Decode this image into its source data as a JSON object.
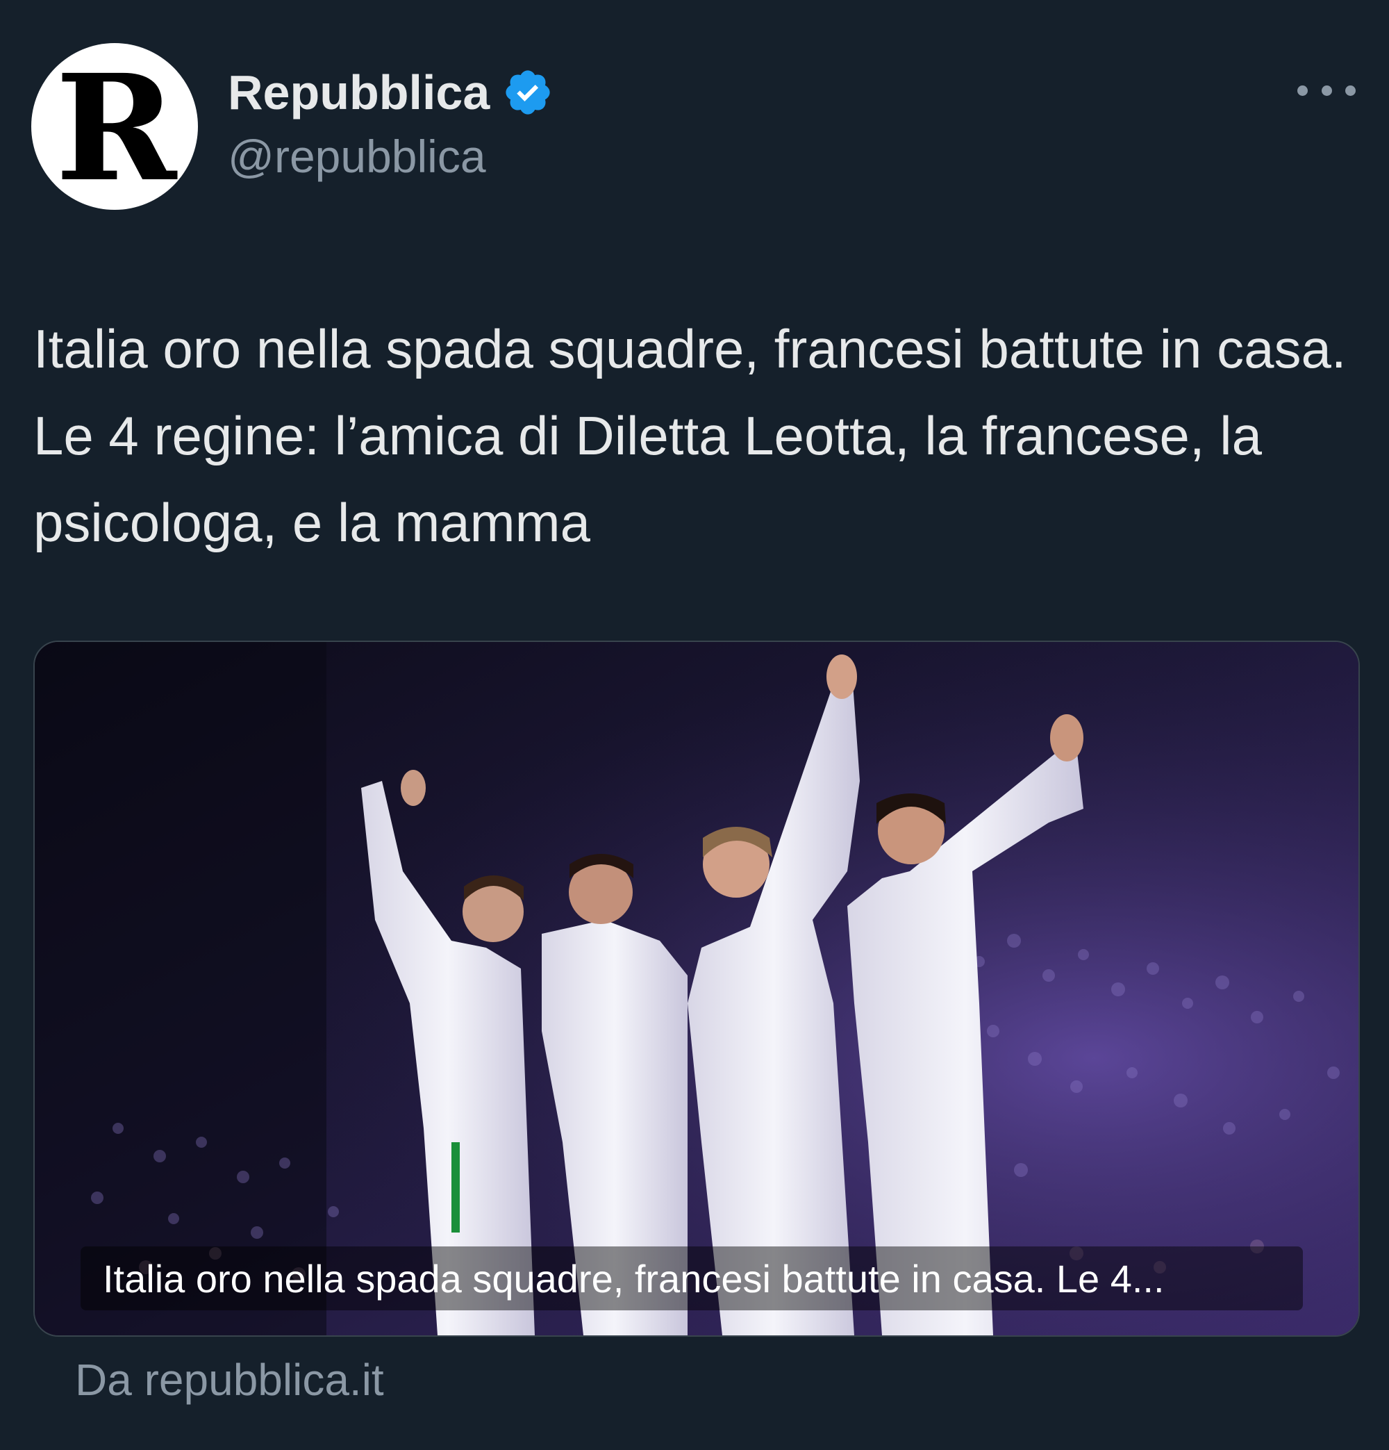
{
  "author": {
    "avatar_letter": "R",
    "display_name": "Repubblica",
    "handle": "@repubblica",
    "verified_icon": "verified-badge-icon",
    "verified_color": "#1d9bf0"
  },
  "menu": {
    "more_icon": "more-horizontal-icon"
  },
  "tweet": {
    "text": "Italia oro nella spada squadre, francesi battute in casa. Le 4 regine: l’amica di Diletta Leotta, la francese, la psicologa, e la mamma"
  },
  "card": {
    "caption": "Italia oro nella spada squadre, francesi battute in casa. Le 4...",
    "source": "Da repubblica.it",
    "image_subject": "four fencers in white uniforms celebrating in an arena"
  },
  "colors": {
    "background": "#15202b",
    "text_primary": "#e7e9ea",
    "text_secondary": "#8b98a5",
    "card_border": "#38444d"
  }
}
